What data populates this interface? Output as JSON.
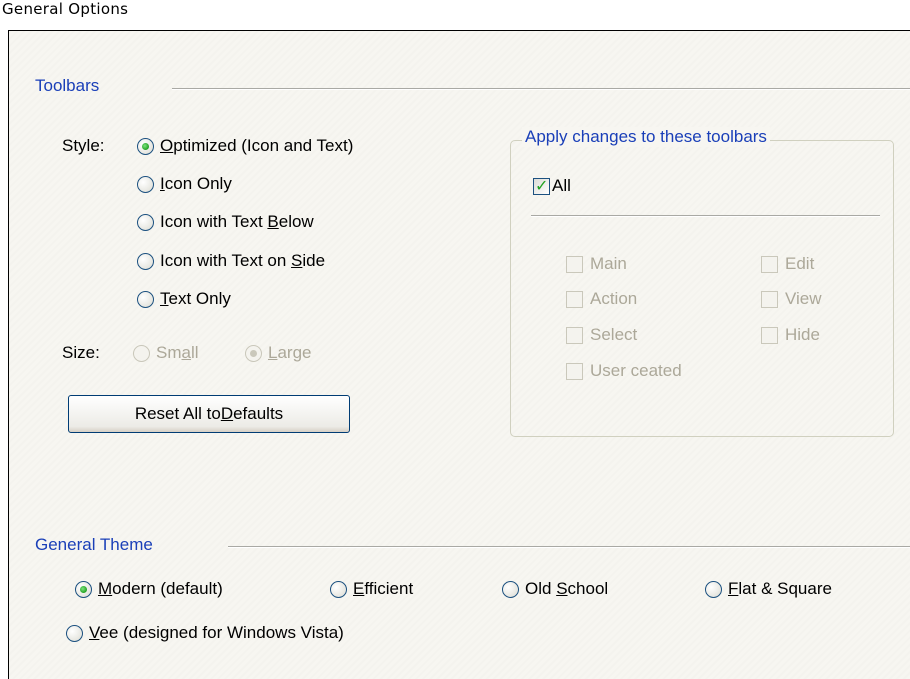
{
  "window": {
    "title": "General Options"
  },
  "toolbars": {
    "section_label": "Toolbars",
    "style_label": "Style:",
    "style_options": [
      {
        "pre": "",
        "key": "O",
        "post": "ptimized (Icon and Text)",
        "checked": true
      },
      {
        "pre": "",
        "key": "I",
        "post": "con Only",
        "checked": false
      },
      {
        "pre": "Icon with Text ",
        "key": "B",
        "post": "elow",
        "checked": false
      },
      {
        "pre": "Icon with Text on ",
        "key": "S",
        "post": "ide",
        "checked": false
      },
      {
        "pre": "",
        "key": "T",
        "post": "ext Only",
        "checked": false
      }
    ],
    "size_label": "Size:",
    "size_small": {
      "pre": "Sm",
      "key": "a",
      "post": "ll"
    },
    "size_large": {
      "pre": "",
      "key": "L",
      "post": "arge"
    },
    "reset_button": {
      "pre": "Reset All to ",
      "key": "D",
      "post": "efaults"
    }
  },
  "apply_group": {
    "title": "Apply changes to these toolbars",
    "all_label": "All",
    "all_checked": true,
    "items": [
      "Main",
      "Edit",
      "Action",
      "View",
      "Select",
      "Hide",
      "User ceated"
    ]
  },
  "theme": {
    "section_label": "General Theme",
    "options": [
      {
        "pre": "",
        "key": "M",
        "post": "odern (default)",
        "checked": true
      },
      {
        "pre": "",
        "key": "E",
        "post": "fficient",
        "checked": false
      },
      {
        "pre": "Old ",
        "key": "S",
        "post": "chool",
        "checked": false
      },
      {
        "pre": "",
        "key": "F",
        "post": "lat & Square",
        "checked": false
      },
      {
        "pre": "",
        "key": "V",
        "post": "ee (designed for Windows Vista)",
        "checked": false
      }
    ]
  },
  "colors": {
    "section_text": "#1a3fb8",
    "radio_dot": "#21a121",
    "disabled_text": "#aca899"
  }
}
